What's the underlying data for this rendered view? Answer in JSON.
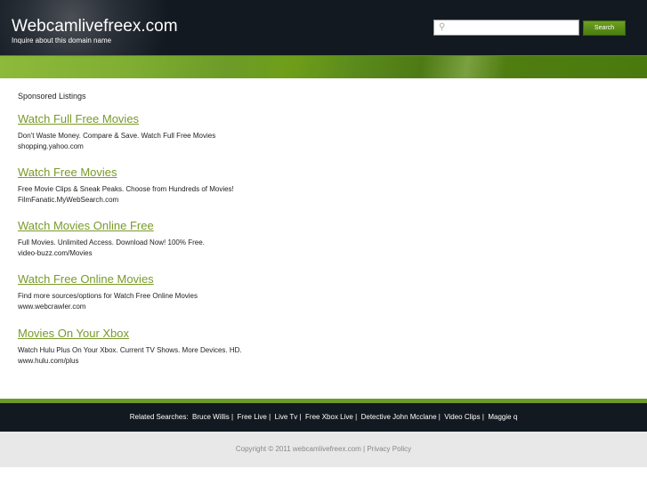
{
  "header": {
    "title": "Webcamlivefreex.com",
    "subtitle": "Inquire about this domain name",
    "search_placeholder": "",
    "search_label": "Search",
    "search_icon": "magnifier-icon"
  },
  "main": {
    "sponsored_label": "Sponsored Listings",
    "listings": [
      {
        "title": "Watch Full Free Movies",
        "description": "Don't Waste Money. Compare & Save. Watch Full Free Movies",
        "url": "shopping.yahoo.com"
      },
      {
        "title": "Watch Free Movies",
        "description": "Free Movie Clips & Sneak Peaks. Choose from Hundreds of Movies!",
        "url": "FilmFanatic.MyWebSearch.com"
      },
      {
        "title": "Watch Movies Online Free",
        "description": "Full Movies. Unlimited Access. Download Now! 100% Free.",
        "url": "video-buzz.com/Movies"
      },
      {
        "title": "Watch Free Online Movies",
        "description": "Find more sources/options for Watch Free Online Movies",
        "url": "www.webcrawler.com"
      },
      {
        "title": "Movies On Your Xbox",
        "description": "Watch Hulu Plus On Your Xbox. Current TV Shows. More Devices. HD.",
        "url": "www.hulu.com/plus"
      }
    ]
  },
  "footer": {
    "related_label": "Related Searches:",
    "related": [
      "Bruce Willis",
      "Free Live",
      "Live Tv",
      "Free Xbox Live",
      "Detective John Mcclane",
      "Video Clips",
      "Maggie q"
    ],
    "copyright": "Copyright © 2011 webcamlivefreex.com",
    "privacy": "Privacy Policy"
  },
  "colors": {
    "accent": "#7a9a2a",
    "header_bg": "#121920"
  }
}
